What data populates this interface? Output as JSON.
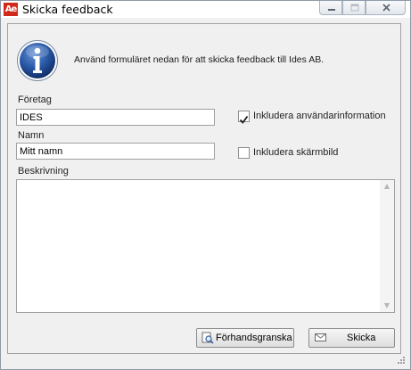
{
  "window": {
    "title": "Skicka feedback",
    "app_icon_text": "Ae"
  },
  "info": {
    "message": "Använd formuläret nedan för att skicka feedback till Ides AB."
  },
  "form": {
    "company_label": "Företag",
    "company_value": "IDES",
    "name_label": "Namn",
    "name_value": "Mitt namn",
    "include_user_info_label": "Inkludera användarinformation",
    "include_user_info_checked": true,
    "include_screenshot_label": "Inkludera skärmbild",
    "include_screenshot_checked": false,
    "description_label": "Beskrivning",
    "description_value": ""
  },
  "buttons": {
    "preview_label": "Förhandsgranska",
    "send_label": "Skicka"
  },
  "colors": {
    "app_icon": "#d12a1c",
    "info_icon": "#1f4fa0"
  }
}
